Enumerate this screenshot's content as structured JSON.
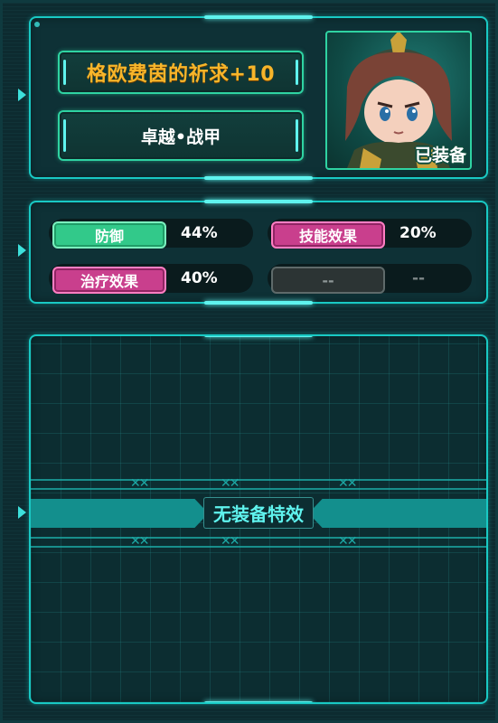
{
  "item": {
    "name": "格欧费茵的祈求+10",
    "type": "卓越•战甲",
    "status": "已装备",
    "portrait": "character-portrait"
  },
  "stats": [
    {
      "label": "防御",
      "value": "44%",
      "color": "#32c98a"
    },
    {
      "label": "技能效果",
      "value": "20%",
      "color": "#c93f8d"
    },
    {
      "label": "治疗效果",
      "value": "40%",
      "color": "#c93f8d"
    },
    {
      "label": "--",
      "value": "--",
      "color": "#2c3434"
    }
  ],
  "special_effect": {
    "text": "无装备特效"
  },
  "colors": {
    "accent": "#19c9c4",
    "title": "#f7b52a",
    "background": "#0d2b30"
  }
}
